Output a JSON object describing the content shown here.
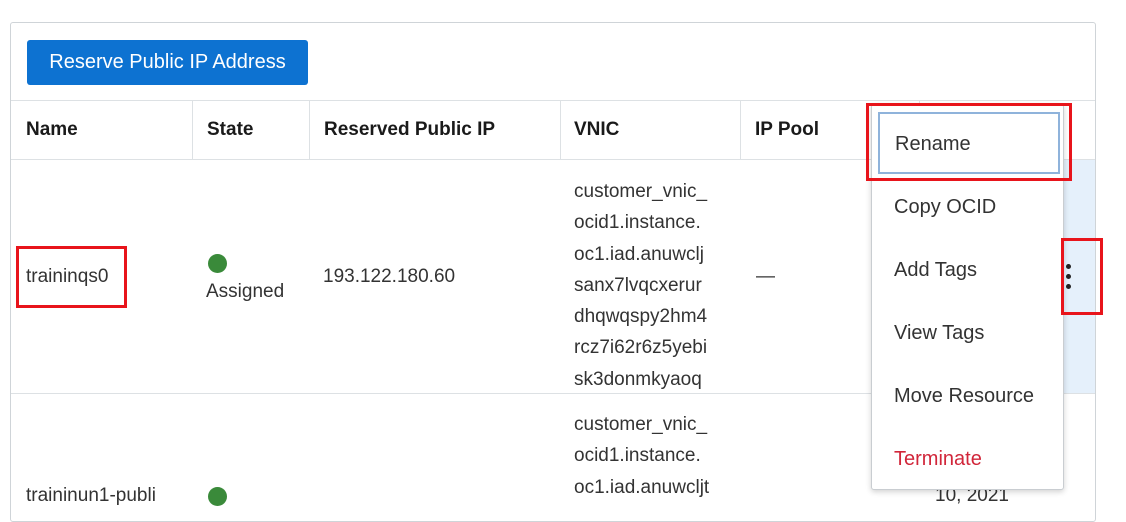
{
  "toolbar": {
    "reserve_label": "Reserve Public IP Address"
  },
  "table": {
    "headers": [
      "Name",
      "State",
      "Reserved Public IP",
      "VNIC",
      "IP Pool"
    ],
    "rows": [
      {
        "name": "traininqs0",
        "state": "Assigned",
        "ip": "193.122.180.60",
        "vnic_lines": [
          "customer_vnic_",
          "ocid1.instance.",
          "oc1.iad.anuwclj",
          "sanx7lvqcxerur",
          "dhqwqspy2hm4",
          "rcz7i62r6z5yebi",
          "sk3donmkyaoq"
        ],
        "pool": "—"
      },
      {
        "name": "traininun1-publi",
        "vnic_lines": [
          "customer_vnic_",
          "ocid1.instance.",
          "oc1.iad.anuwcljt"
        ],
        "trailing": "10, 2021"
      }
    ]
  },
  "menu": {
    "items": [
      "Rename",
      "Copy OCID",
      "Add Tags",
      "View Tags",
      "Move Resource",
      "Terminate"
    ]
  },
  "colors": {
    "primary": "#0d72d1",
    "danger": "#d1263a",
    "assigned": "#3a8a3a",
    "highlight": "#e8141b"
  }
}
